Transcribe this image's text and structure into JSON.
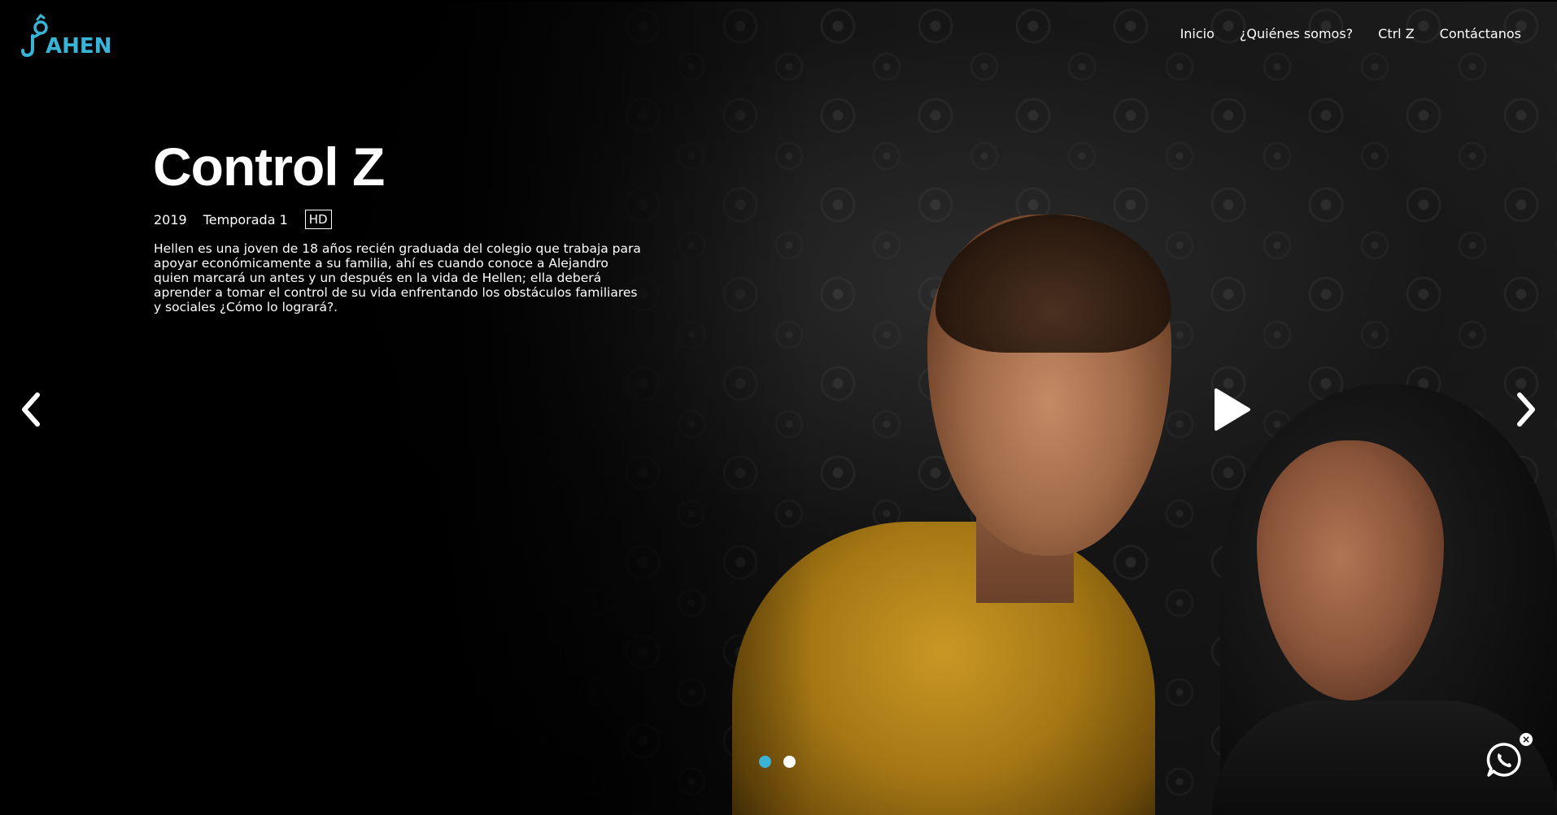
{
  "brand": {
    "logo_text": "AHEN",
    "logo_color": "#3ab4d6"
  },
  "nav": {
    "items": [
      "Inicio",
      "¿Quiénes somos?",
      "Ctrl Z",
      "Contáctanos"
    ]
  },
  "hero": {
    "title": "Control Z",
    "year": "2019",
    "season": "Temporada 1",
    "quality_badge": "HD",
    "description": "Hellen es una joven de 18 años recién graduada del colegio que trabaja para apoyar económicamente a su familia, ahí es cuando conoce a Alejandro quien marcará un antes y un después en la vida de Hellen; ella deberá aprender a tomar el control de su vida enfrentando los obstáculos familiares y sociales ¿Cómo lo logrará?."
  },
  "carousel": {
    "prev_icon": "chevron-left-icon",
    "next_icon": "chevron-right-icon",
    "play_icon": "play-icon",
    "slides": 2,
    "active_slide": 1
  },
  "whatsapp": {
    "icon": "whatsapp-icon",
    "close_label": "×"
  },
  "colors": {
    "accent": "#3ab4d6",
    "background": "#000000",
    "text": "#ffffff"
  }
}
